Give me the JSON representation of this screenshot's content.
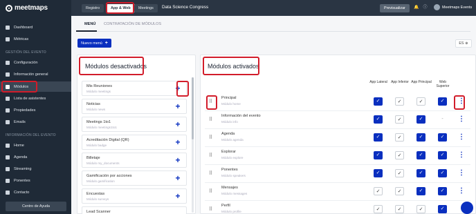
{
  "brand": {
    "logo": "meetmaps"
  },
  "sidebar": {
    "items": [
      {
        "label": "Dashboard",
        "icon": "dashboard-icon"
      },
      {
        "label": "Métricas",
        "icon": "chart-icon"
      },
      {
        "label": "Configuración",
        "icon": "gear-icon"
      },
      {
        "label": "Información general",
        "icon": "info-icon"
      },
      {
        "label": "Módulos",
        "icon": "list-icon"
      },
      {
        "label": "Lista de asistentes",
        "icon": "people-icon"
      },
      {
        "label": "Propiedades",
        "icon": "folder-icon"
      },
      {
        "label": "Emails",
        "icon": "mail-icon"
      },
      {
        "label": "Home",
        "icon": "home-icon"
      },
      {
        "label": "Agenda",
        "icon": "calendar-icon"
      },
      {
        "label": "Streaming",
        "icon": "stream-icon"
      },
      {
        "label": "Ponentes",
        "icon": "mic-icon"
      },
      {
        "label": "Contacto",
        "icon": "contact-icon"
      }
    ],
    "section_event": "GESTIÓN DEL EVENTO",
    "section_info": "INFORMACIÓN DEL EVENTO",
    "help": "Centro de Ayuda"
  },
  "topbar": {
    "registro": "Registro",
    "appweb": "App & Web",
    "meetings": "Meetings",
    "event_title": "Data Science Congress",
    "preview": "Previsualizar",
    "user": "Meetmaps Events"
  },
  "tabs": {
    "menu": "MENÚ",
    "contract": "CONTRATACIÓN DE MÓDULOS"
  },
  "actions": {
    "new_menu": "Nuevo menú",
    "lang": "ES"
  },
  "left_panel": {
    "title": "Módulos desactivados",
    "modules": [
      {
        "name": "Mis Reuniones",
        "sub": "Módulo meetings"
      },
      {
        "name": "Noticias",
        "sub": "Módulo news"
      },
      {
        "name": "Meetings 1to1",
        "sub": "Módulo meetings1to1"
      },
      {
        "name": "Acreditación Digital (QR)",
        "sub": "Módulo badge"
      },
      {
        "name": "Billetaje",
        "sub": "Módulo my_documents"
      },
      {
        "name": "Gamificación por acciones",
        "sub": "Módulo gamification"
      },
      {
        "name": "Encuestas",
        "sub": "Módulo surveys"
      },
      {
        "name": "Lead Scanner",
        "sub": ""
      }
    ]
  },
  "right_panel": {
    "title": "Módulos activados",
    "columns": [
      "App Lateral",
      "App Inferior",
      "App Principal",
      "Web Superior"
    ],
    "modules": [
      {
        "name": "Principal",
        "sub": "Módulo home",
        "checks": [
          "on",
          "off",
          "off",
          "on"
        ]
      },
      {
        "name": "Información del evento",
        "sub": "Módulo info",
        "checks": [
          "on",
          "off",
          "on",
          "na"
        ]
      },
      {
        "name": "Agenda",
        "sub": "Módulo agenda",
        "checks": [
          "on",
          "off",
          "on",
          "on"
        ]
      },
      {
        "name": "Explorar",
        "sub": "Módulo explore",
        "checks": [
          "on",
          "off",
          "on",
          "on"
        ]
      },
      {
        "name": "Ponentes",
        "sub": "Módulo speakers",
        "checks": [
          "on",
          "off",
          "on",
          "on"
        ]
      },
      {
        "name": "Mensajes",
        "sub": "Módulo messages",
        "checks": [
          "off",
          "off",
          "on",
          "on"
        ]
      },
      {
        "name": "Perfil",
        "sub": "Módulo profile",
        "checks": [
          "off",
          "off",
          "off",
          "on"
        ]
      }
    ]
  }
}
